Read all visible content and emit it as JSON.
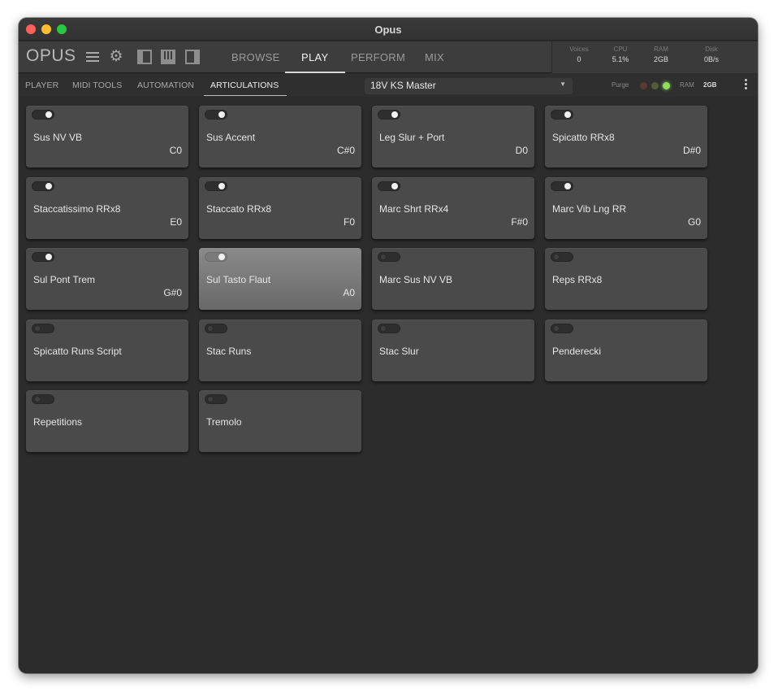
{
  "window": {
    "title": "Opus"
  },
  "toolbar": {
    "logo": "OPUS",
    "tabs": [
      "BROWSE",
      "PLAY",
      "PERFORM",
      "MIX"
    ],
    "active_tab": "PLAY",
    "stats": [
      {
        "label": "Voices",
        "value": "0"
      },
      {
        "label": "CPU",
        "value": "5.1%"
      },
      {
        "label": "RAM",
        "value": "2GB"
      },
      {
        "label": "Disk",
        "value": "0B/s"
      }
    ]
  },
  "subbar": {
    "tabs": [
      "PLAYER",
      "MIDI TOOLS",
      "AUTOMATION",
      "ARTICULATIONS"
    ],
    "active_tab": "ARTICULATIONS",
    "preset": "18V KS Master",
    "purge_label": "Purge",
    "ram_label": "RAM",
    "ram_value": "2GB"
  },
  "articulations": [
    {
      "name": "Sus NV VB",
      "key": "C0",
      "enabled": true,
      "selected": false
    },
    {
      "name": "Sus Accent",
      "key": "C#0",
      "enabled": true,
      "selected": false
    },
    {
      "name": "Leg Slur + Port",
      "key": "D0",
      "enabled": true,
      "selected": false
    },
    {
      "name": "Spicatto RRx8",
      "key": "D#0",
      "enabled": true,
      "selected": false
    },
    {
      "name": "Staccatissimo RRx8",
      "key": "E0",
      "enabled": true,
      "selected": false
    },
    {
      "name": "Staccato RRx8",
      "key": "F0",
      "enabled": true,
      "selected": false
    },
    {
      "name": "Marc Shrt RRx4",
      "key": "F#0",
      "enabled": true,
      "selected": false
    },
    {
      "name": "Marc Vib Lng RR",
      "key": "G0",
      "enabled": true,
      "selected": false
    },
    {
      "name": "Sul Pont Trem",
      "key": "G#0",
      "enabled": true,
      "selected": false
    },
    {
      "name": "Sul Tasto Flaut",
      "key": "A0",
      "enabled": true,
      "selected": true
    },
    {
      "name": "Marc Sus NV VB",
      "key": "",
      "enabled": false,
      "selected": false
    },
    {
      "name": "Reps RRx8",
      "key": "",
      "enabled": false,
      "selected": false
    },
    {
      "name": "Spicatto Runs Script",
      "key": "",
      "enabled": false,
      "selected": false
    },
    {
      "name": "Stac Runs",
      "key": "",
      "enabled": false,
      "selected": false
    },
    {
      "name": "Stac Slur",
      "key": "",
      "enabled": false,
      "selected": false
    },
    {
      "name": "Penderecki",
      "key": "",
      "enabled": false,
      "selected": false
    },
    {
      "name": "Repetitions",
      "key": "",
      "enabled": false,
      "selected": false
    },
    {
      "name": "Tremolo",
      "key": "",
      "enabled": false,
      "selected": false
    }
  ]
}
